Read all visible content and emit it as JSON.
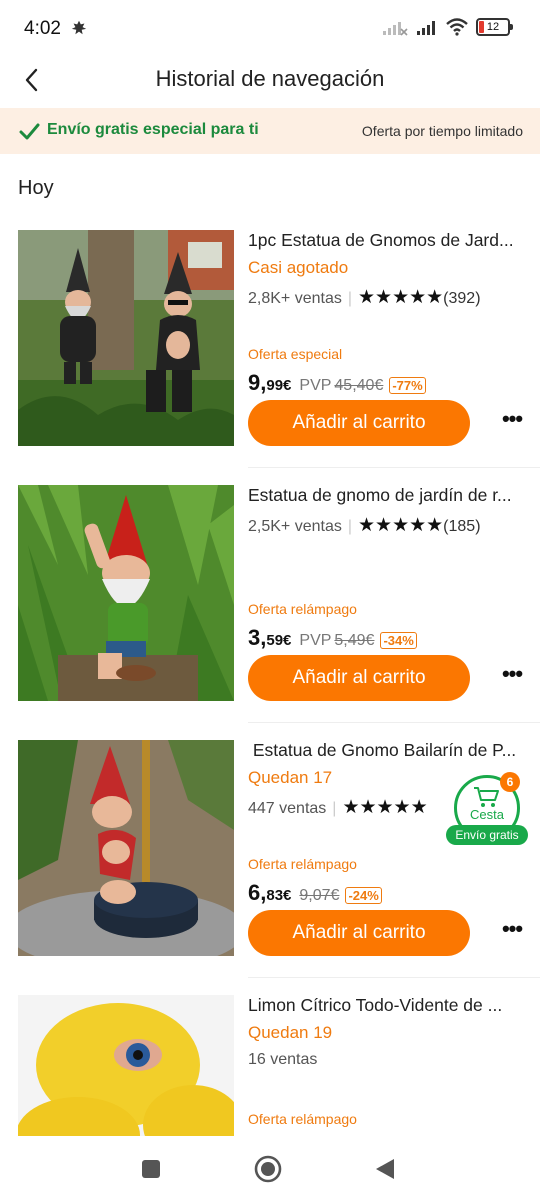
{
  "status_bar": {
    "time": "4:02",
    "battery": "12",
    "icons": [
      "leaf-icon",
      "signal-off-icon",
      "signal-icon",
      "wifi-icon",
      "battery-icon"
    ]
  },
  "header": {
    "title": "Historial de navegación",
    "back_icon": "chevron-left-icon"
  },
  "promo": {
    "left_text": "Envío gratis especial para ti",
    "right_text": "Oferta por tiempo limitado",
    "accent": "#1c8a3d",
    "background": "#fdefe3"
  },
  "section": {
    "title": "Hoy"
  },
  "colors": {
    "brand_orange": "#fb7701",
    "stock_orange": "#ef7b10",
    "green": "#19a94a"
  },
  "products": [
    {
      "title": "1pc Estatua de Gnomos de Jard...",
      "stock": "Casi agotado",
      "sales": "2,8K+ ventas",
      "stars": "★★★★★",
      "rating_count": "(392)",
      "offer": "Oferta especial",
      "price_int": "9,",
      "price_dec": "99€",
      "pvp_label": "PVP",
      "pvp_old": "45,40€",
      "discount": "-77%",
      "cart_label": "Añadir al carrito",
      "more": "•••"
    },
    {
      "title": "Estatua de gnomo de jardín de r...",
      "stock": "",
      "sales": "2,5K+ ventas",
      "stars": "★★★★★",
      "rating_count": "(185)",
      "offer": "Oferta relámpago",
      "price_int": "3,",
      "price_dec": "59€",
      "pvp_label": "PVP",
      "pvp_old": "5,49€",
      "discount": "-34%",
      "cart_label": "Añadir al carrito",
      "more": "•••"
    },
    {
      "title": " Estatua de Gnomo Bailarín de P...",
      "stock": "Quedan 17",
      "sales": "447 ventas",
      "stars": "★★★★★",
      "rating_count": "",
      "offer": "Oferta relámpago",
      "price_int": "6,",
      "price_dec": "83€",
      "pvp_label": "",
      "pvp_old": "9,07€",
      "discount": "-24%",
      "cart_label": "Añadir al carrito",
      "more": "•••"
    },
    {
      "title": "Limon Cítrico Todo-Vidente de ...",
      "stock": "Quedan 19",
      "sales": "16 ventas",
      "offer": "Oferta relámpago"
    }
  ],
  "floating_cart": {
    "badge": "6",
    "label": "Cesta",
    "free_shipping": "Envío gratis"
  },
  "nav": {
    "icons": [
      "recents-square-icon",
      "home-circle-icon",
      "back-triangle-icon"
    ]
  }
}
